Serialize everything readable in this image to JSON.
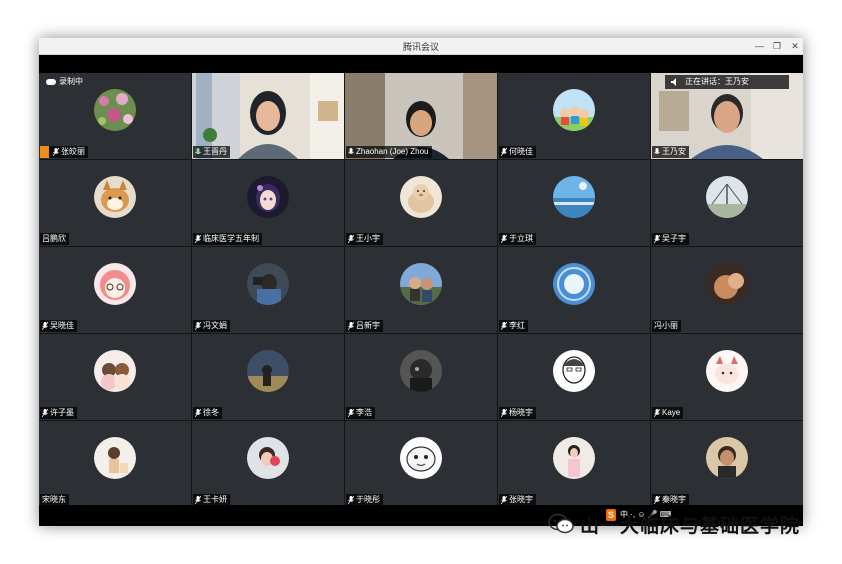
{
  "window": {
    "title": "腾讯会议"
  },
  "recording": {
    "text": "录制中"
  },
  "speaking": {
    "text": "正在讲话：王乃安"
  },
  "watermark": {
    "text": "山一大临床与基础医学院"
  },
  "ime": {
    "badge": "S",
    "text": "中 ·, ☺ 🎤 ⌨"
  },
  "participants": [
    {
      "name": "张皎丽",
      "mic": "muted",
      "host": true
    },
    {
      "name": "王晋丹",
      "mic": "on",
      "speaking": true
    },
    {
      "name": "Zhaohan (Joe) Zhou",
      "mic": "on"
    },
    {
      "name": "何晓佳",
      "mic": "muted"
    },
    {
      "name": "王乃安",
      "mic": "on"
    },
    {
      "name": "吕鹏欣",
      "mic": "none"
    },
    {
      "name": "临床医学五年制",
      "mic": "muted"
    },
    {
      "name": "王小宇",
      "mic": "muted"
    },
    {
      "name": "于立琪",
      "mic": "muted"
    },
    {
      "name": "吴子宇",
      "mic": "muted"
    },
    {
      "name": "吴晓佳",
      "mic": "muted"
    },
    {
      "name": "冯文娟",
      "mic": "muted"
    },
    {
      "name": "吕新宇",
      "mic": "muted"
    },
    {
      "name": "李红",
      "mic": "muted"
    },
    {
      "name": "冯小丽",
      "mic": "none"
    },
    {
      "name": "许子墨",
      "mic": "muted"
    },
    {
      "name": "徐冬",
      "mic": "muted"
    },
    {
      "name": "李浩",
      "mic": "muted"
    },
    {
      "name": "杨晓宇",
      "mic": "muted"
    },
    {
      "name": "Kaye",
      "mic": "muted"
    },
    {
      "name": "宋晓东",
      "mic": "none"
    },
    {
      "name": "王卡妍",
      "mic": "muted"
    },
    {
      "name": "于晓彤",
      "mic": "muted"
    },
    {
      "name": "张晓宇",
      "mic": "muted"
    },
    {
      "name": "秦晓宇",
      "mic": "muted"
    }
  ]
}
